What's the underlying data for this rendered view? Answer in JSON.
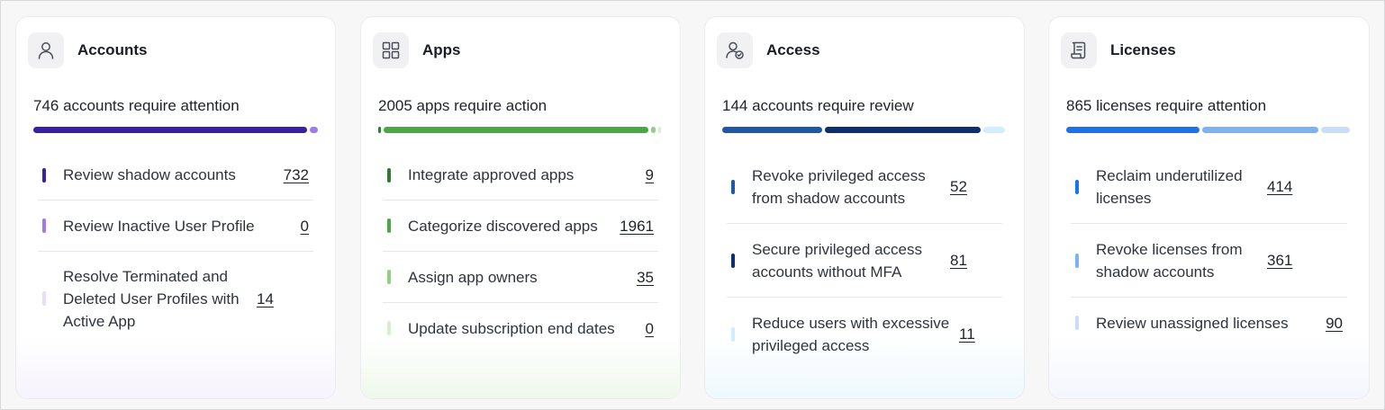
{
  "colors": {
    "accounts": [
      "#3b1fa3",
      "#9f7aea",
      "#e6ddf8"
    ],
    "apps": [
      "#2e7d32",
      "#49a83f",
      "#8fd17f",
      "#d6f0cf"
    ],
    "access": [
      "#1c5aa6",
      "#0d2f6e",
      "#cfefff"
    ],
    "licenses": [
      "#1a73e8",
      "#7db3f0",
      "#c9dff8"
    ]
  },
  "cards": {
    "accounts": {
      "icon": "user-icon",
      "title": "Accounts",
      "summary": "746 accounts require attention",
      "bar": [
        0.97,
        0.03
      ],
      "items": [
        {
          "label": "Review shadow accounts",
          "count": "732"
        },
        {
          "label": "Review Inactive User Profile",
          "count": "0"
        },
        {
          "label": "Resolve Terminated and Deleted User Profiles with Active App",
          "count": "14"
        }
      ]
    },
    "apps": {
      "icon": "grid-icon",
      "title": "Apps",
      "summary": "2005 apps require action",
      "bar": [
        0.005,
        0.977,
        0.017,
        0.0
      ],
      "items": [
        {
          "label": "Integrate approved apps",
          "count": "9"
        },
        {
          "label": "Categorize discovered apps",
          "count": "1961"
        },
        {
          "label": "Assign app owners",
          "count": "35"
        },
        {
          "label": "Update subscription end dates",
          "count": "0"
        }
      ]
    },
    "access": {
      "icon": "user-check-icon",
      "title": "Access",
      "summary": "144 accounts require review",
      "bar": [
        0.36,
        0.563,
        0.076
      ],
      "items": [
        {
          "label": "Revoke privileged access from shadow accounts",
          "count": "52"
        },
        {
          "label": "Secure privileged access accounts without MFA",
          "count": "81"
        },
        {
          "label": "Reduce users with excessive privileged access",
          "count": "11"
        }
      ]
    },
    "licenses": {
      "icon": "document-icon",
      "title": "Licenses",
      "summary": "865 licenses require attention",
      "bar": [
        0.479,
        0.417,
        0.104
      ],
      "items": [
        {
          "label": "Reclaim underutilized licenses",
          "count": "414"
        },
        {
          "label": "Revoke licenses from shadow accounts",
          "count": "361"
        },
        {
          "label": "Review unassigned licenses",
          "count": "90"
        }
      ]
    }
  }
}
